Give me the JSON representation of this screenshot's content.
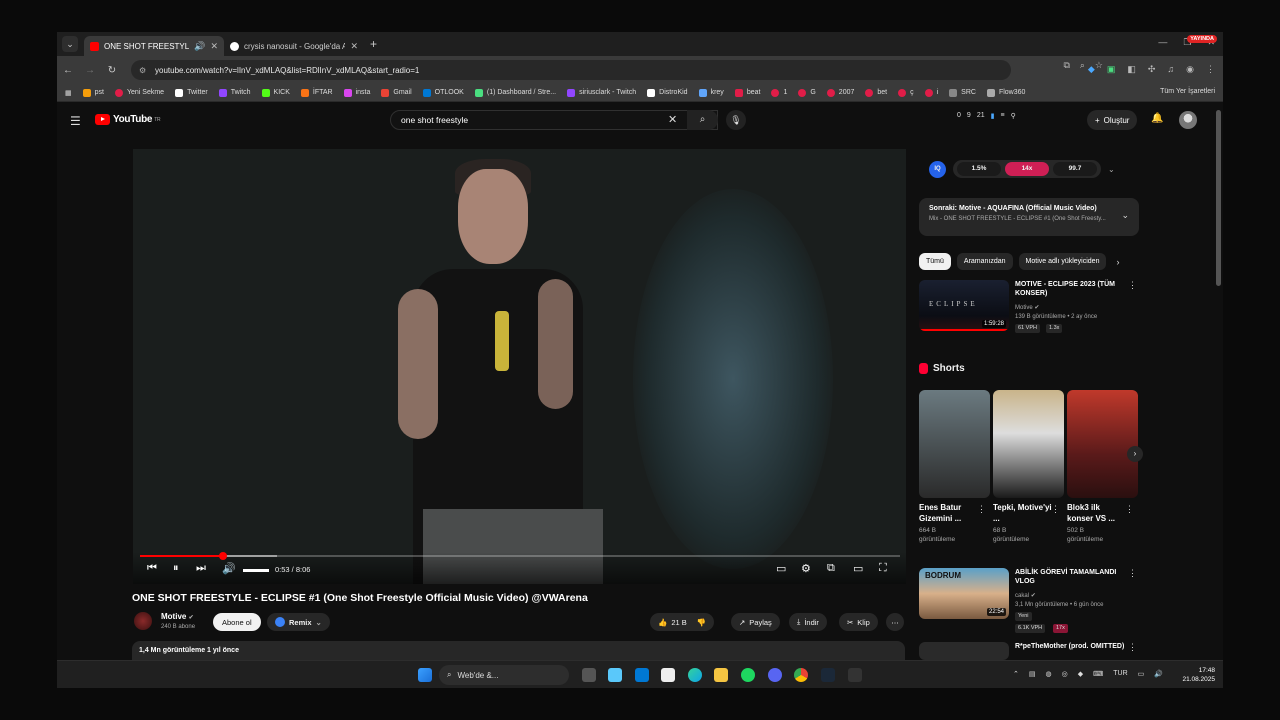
{
  "browser": {
    "tabs": [
      {
        "title": "ONE SHOT FREESTYLE - EC",
        "active": true
      },
      {
        "title": "crysis nanosuit - Google'da Ara",
        "active": false
      }
    ],
    "new_tab": "+",
    "live_badge": "YAYINDA",
    "url": "youtube.com/watch?v=lInV_xdMLAQ&list=RDlInV_xdMLAQ&start_radio=1",
    "bookmarks": [
      "pst",
      "Yeni Sekme",
      "Twitter",
      "Twitch",
      "KICK",
      "İFTAR",
      "insta",
      "Gmail",
      "OTLOOK",
      "(1) Dashboard / Stre...",
      "siriusclark - Twitch",
      "DistroKid",
      "krey",
      "beat",
      "1",
      "G",
      "2007",
      "bet",
      "ç",
      "i",
      "SRC",
      "Flow360"
    ],
    "bookmarks_other": "Tüm Yer İşaretleri"
  },
  "youtube": {
    "logo": "YouTube",
    "logo_region": "TR",
    "search_query": "one shot freestyle",
    "header_stats": [
      "0",
      "9",
      "21"
    ],
    "create_label": "Oluştur"
  },
  "player": {
    "time": "0:53 / 8:06",
    "progress": 0.109
  },
  "video": {
    "title": "ONE SHOT FREESTYLE - ECLIPSE #1 (One Shot Freestyle Official Music Video) @VWArena",
    "channel": "Motive",
    "subscribers": "240 B abone",
    "subscribe_label": "Abone ol",
    "remix_label": "Remix",
    "likes": "21 B",
    "share_label": "Paylaş",
    "download_label": "İndir",
    "clip_label": "Klip",
    "views_date": "1,4 Mn görüntüleme  1 yıl önce"
  },
  "sidebar": {
    "iq": "IQ",
    "pills": [
      "1.5%",
      "14x",
      "99.7"
    ],
    "next_title": "Sonraki: Motive - AQUAFINA (Official Music Video)",
    "next_sub": "Mix - ONE SHOT FREESTYLE - ECLIPSE #1 (One Shot Freesty...",
    "chips": [
      "Tümü",
      "Aramanızdan",
      "Motive adlı yükleyiciden"
    ],
    "rec1": {
      "title": "MOTIVE - ECLIPSE 2023 (TÜM KONSER)",
      "channel": "Motive",
      "meta": "139 B görüntüleme • 2 ay önce",
      "duration": "1:59:28",
      "tag1": "61 VPH",
      "tag2": "1.3x"
    },
    "shorts_heading": "Shorts",
    "shorts": [
      {
        "title": "Enes Batur Gizemini ...",
        "views": "664 B",
        "views_label": "görüntüleme"
      },
      {
        "title": "Tepki, Motive'yi ...",
        "views": "68 B",
        "views_label": "görüntüleme"
      },
      {
        "title": "Blok3 ilk konser VS ...",
        "views": "502 B",
        "views_label": "görüntüleme"
      }
    ],
    "rec2": {
      "title": "ABİLİK GÖREVİ TAMAMLANDI VLOG",
      "channel": "cakal",
      "meta": "3,1 Mn görüntüleme • 6 gün önce",
      "new": "Yeni",
      "duration": "22:54",
      "tag1": "6.1K VPH",
      "tag2": "17x",
      "thumb_text": "BODRUM"
    },
    "rec3": {
      "title": "R*peTheMother (prod. OMITTED)"
    }
  },
  "taskbar": {
    "search_placeholder": "Web'de &...",
    "lang": "TUR",
    "time": "17:48",
    "date": "21.08.2025"
  },
  "colors": {
    "accent_red": "#ff0000",
    "pill_accent": "#cf1f55",
    "bg": "#0f0f0f"
  }
}
